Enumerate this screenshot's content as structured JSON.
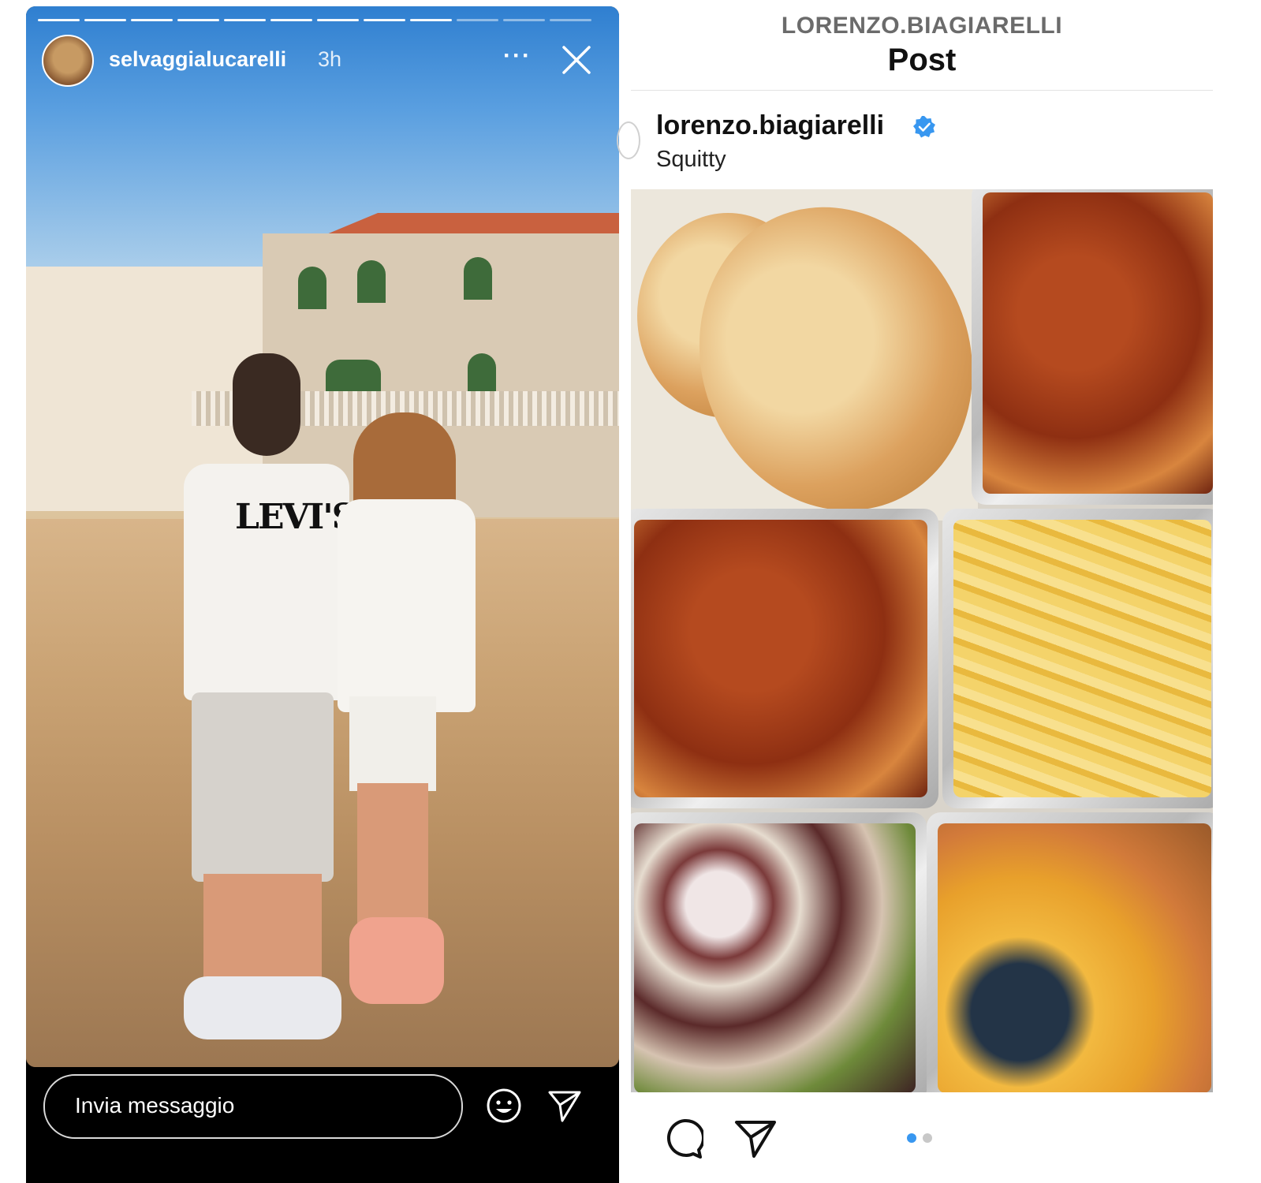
{
  "story": {
    "username": "selvaggialucarelli",
    "time": "3h",
    "more_label": "···",
    "reply_placeholder": "Invia messaggio",
    "shirt_print": "LEVI'S",
    "progress_segments": 12,
    "progress_active_index": 9,
    "icons": [
      "more-icon",
      "close-icon",
      "emoji-icon",
      "send-icon"
    ]
  },
  "post": {
    "header_account": "LORENZO.BIAGIARELLI",
    "header_title": "Post",
    "username": "lorenzo.biagiarelli",
    "location": "Squitty",
    "verified": true,
    "accent_color": "#3897f0",
    "carousel_count": 2,
    "carousel_active": 1,
    "icons": [
      "verified-badge-icon",
      "comment-icon",
      "send-icon"
    ]
  }
}
